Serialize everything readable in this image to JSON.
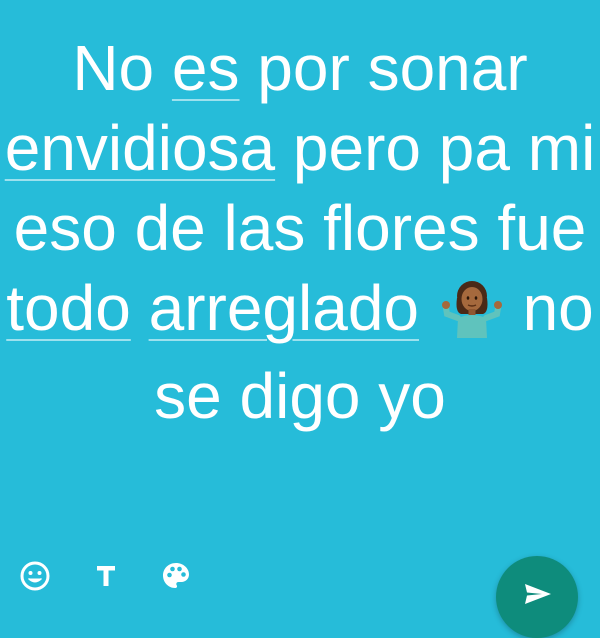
{
  "status": {
    "words": [
      {
        "t": "No ",
        "flag": false
      },
      {
        "t": "es",
        "flag": true
      },
      {
        "t": " por sonar ",
        "flag": false
      },
      {
        "t": "envidiosa",
        "flag": true
      },
      {
        "t": " pero pa mi eso de las flores fue ",
        "flag": false
      },
      {
        "t": "todo",
        "flag": true
      },
      {
        "t": " ",
        "flag": false
      },
      {
        "t": "arreglado",
        "flag": true
      },
      {
        "t": " ",
        "flag": false
      },
      {
        "t": "no se digo yo",
        "flag": false
      }
    ],
    "emoji": "person-shrugging-emoji",
    "background_color": "#26bcd9",
    "text_color": "#ffffff"
  },
  "toolbar": {
    "icons": [
      "emoji-icon",
      "text-style-icon",
      "palette-icon"
    ]
  },
  "send": {
    "icon": "send-icon",
    "color": "#0e8c7c"
  }
}
